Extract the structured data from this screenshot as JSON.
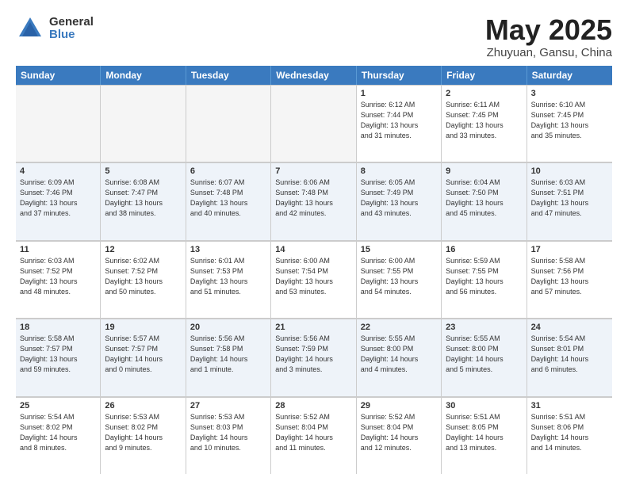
{
  "logo": {
    "general": "General",
    "blue": "Blue"
  },
  "title": "May 2025",
  "subtitle": "Zhuyuan, Gansu, China",
  "days": [
    "Sunday",
    "Monday",
    "Tuesday",
    "Wednesday",
    "Thursday",
    "Friday",
    "Saturday"
  ],
  "rows": [
    [
      {
        "num": "",
        "text": "",
        "empty": true
      },
      {
        "num": "",
        "text": "",
        "empty": true
      },
      {
        "num": "",
        "text": "",
        "empty": true
      },
      {
        "num": "",
        "text": "",
        "empty": true
      },
      {
        "num": "1",
        "text": "Sunrise: 6:12 AM\nSunset: 7:44 PM\nDaylight: 13 hours\nand 31 minutes."
      },
      {
        "num": "2",
        "text": "Sunrise: 6:11 AM\nSunset: 7:45 PM\nDaylight: 13 hours\nand 33 minutes."
      },
      {
        "num": "3",
        "text": "Sunrise: 6:10 AM\nSunset: 7:45 PM\nDaylight: 13 hours\nand 35 minutes."
      }
    ],
    [
      {
        "num": "4",
        "text": "Sunrise: 6:09 AM\nSunset: 7:46 PM\nDaylight: 13 hours\nand 37 minutes."
      },
      {
        "num": "5",
        "text": "Sunrise: 6:08 AM\nSunset: 7:47 PM\nDaylight: 13 hours\nand 38 minutes."
      },
      {
        "num": "6",
        "text": "Sunrise: 6:07 AM\nSunset: 7:48 PM\nDaylight: 13 hours\nand 40 minutes."
      },
      {
        "num": "7",
        "text": "Sunrise: 6:06 AM\nSunset: 7:48 PM\nDaylight: 13 hours\nand 42 minutes."
      },
      {
        "num": "8",
        "text": "Sunrise: 6:05 AM\nSunset: 7:49 PM\nDaylight: 13 hours\nand 43 minutes."
      },
      {
        "num": "9",
        "text": "Sunrise: 6:04 AM\nSunset: 7:50 PM\nDaylight: 13 hours\nand 45 minutes."
      },
      {
        "num": "10",
        "text": "Sunrise: 6:03 AM\nSunset: 7:51 PM\nDaylight: 13 hours\nand 47 minutes."
      }
    ],
    [
      {
        "num": "11",
        "text": "Sunrise: 6:03 AM\nSunset: 7:52 PM\nDaylight: 13 hours\nand 48 minutes."
      },
      {
        "num": "12",
        "text": "Sunrise: 6:02 AM\nSunset: 7:52 PM\nDaylight: 13 hours\nand 50 minutes."
      },
      {
        "num": "13",
        "text": "Sunrise: 6:01 AM\nSunset: 7:53 PM\nDaylight: 13 hours\nand 51 minutes."
      },
      {
        "num": "14",
        "text": "Sunrise: 6:00 AM\nSunset: 7:54 PM\nDaylight: 13 hours\nand 53 minutes."
      },
      {
        "num": "15",
        "text": "Sunrise: 6:00 AM\nSunset: 7:55 PM\nDaylight: 13 hours\nand 54 minutes."
      },
      {
        "num": "16",
        "text": "Sunrise: 5:59 AM\nSunset: 7:55 PM\nDaylight: 13 hours\nand 56 minutes."
      },
      {
        "num": "17",
        "text": "Sunrise: 5:58 AM\nSunset: 7:56 PM\nDaylight: 13 hours\nand 57 minutes."
      }
    ],
    [
      {
        "num": "18",
        "text": "Sunrise: 5:58 AM\nSunset: 7:57 PM\nDaylight: 13 hours\nand 59 minutes."
      },
      {
        "num": "19",
        "text": "Sunrise: 5:57 AM\nSunset: 7:57 PM\nDaylight: 14 hours\nand 0 minutes."
      },
      {
        "num": "20",
        "text": "Sunrise: 5:56 AM\nSunset: 7:58 PM\nDaylight: 14 hours\nand 1 minute."
      },
      {
        "num": "21",
        "text": "Sunrise: 5:56 AM\nSunset: 7:59 PM\nDaylight: 14 hours\nand 3 minutes."
      },
      {
        "num": "22",
        "text": "Sunrise: 5:55 AM\nSunset: 8:00 PM\nDaylight: 14 hours\nand 4 minutes."
      },
      {
        "num": "23",
        "text": "Sunrise: 5:55 AM\nSunset: 8:00 PM\nDaylight: 14 hours\nand 5 minutes."
      },
      {
        "num": "24",
        "text": "Sunrise: 5:54 AM\nSunset: 8:01 PM\nDaylight: 14 hours\nand 6 minutes."
      }
    ],
    [
      {
        "num": "25",
        "text": "Sunrise: 5:54 AM\nSunset: 8:02 PM\nDaylight: 14 hours\nand 8 minutes."
      },
      {
        "num": "26",
        "text": "Sunrise: 5:53 AM\nSunset: 8:02 PM\nDaylight: 14 hours\nand 9 minutes."
      },
      {
        "num": "27",
        "text": "Sunrise: 5:53 AM\nSunset: 8:03 PM\nDaylight: 14 hours\nand 10 minutes."
      },
      {
        "num": "28",
        "text": "Sunrise: 5:52 AM\nSunset: 8:04 PM\nDaylight: 14 hours\nand 11 minutes."
      },
      {
        "num": "29",
        "text": "Sunrise: 5:52 AM\nSunset: 8:04 PM\nDaylight: 14 hours\nand 12 minutes."
      },
      {
        "num": "30",
        "text": "Sunrise: 5:51 AM\nSunset: 8:05 PM\nDaylight: 14 hours\nand 13 minutes."
      },
      {
        "num": "31",
        "text": "Sunrise: 5:51 AM\nSunset: 8:06 PM\nDaylight: 14 hours\nand 14 minutes."
      }
    ]
  ]
}
